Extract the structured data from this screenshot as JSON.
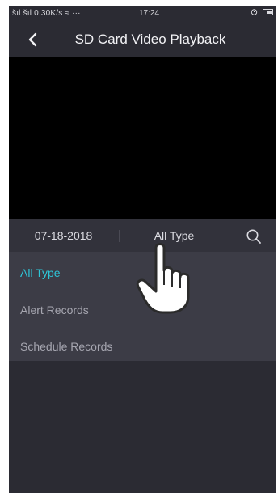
{
  "status_bar": {
    "signal_text": "šıl šıl 0.30K/s ≈ ···",
    "time": "17:24",
    "alarm_icon": "alarm-icon",
    "battery_icon": "battery-icon"
  },
  "nav": {
    "title": "SD Card Video Playback",
    "back_icon": "chevron-left-icon"
  },
  "filter": {
    "date": "07-18-2018",
    "type": "All Type",
    "search_icon": "search-icon"
  },
  "dropdown": {
    "items": [
      {
        "label": "All Type",
        "selected": true
      },
      {
        "label": "Alert Records",
        "selected": false
      },
      {
        "label": "Schedule Records",
        "selected": false
      }
    ]
  },
  "overlay": {
    "pointer_icon": "hand-pointer-icon"
  },
  "colors": {
    "accent": "#2ec4d6",
    "background": "#2b2b33",
    "video": "#000000"
  }
}
